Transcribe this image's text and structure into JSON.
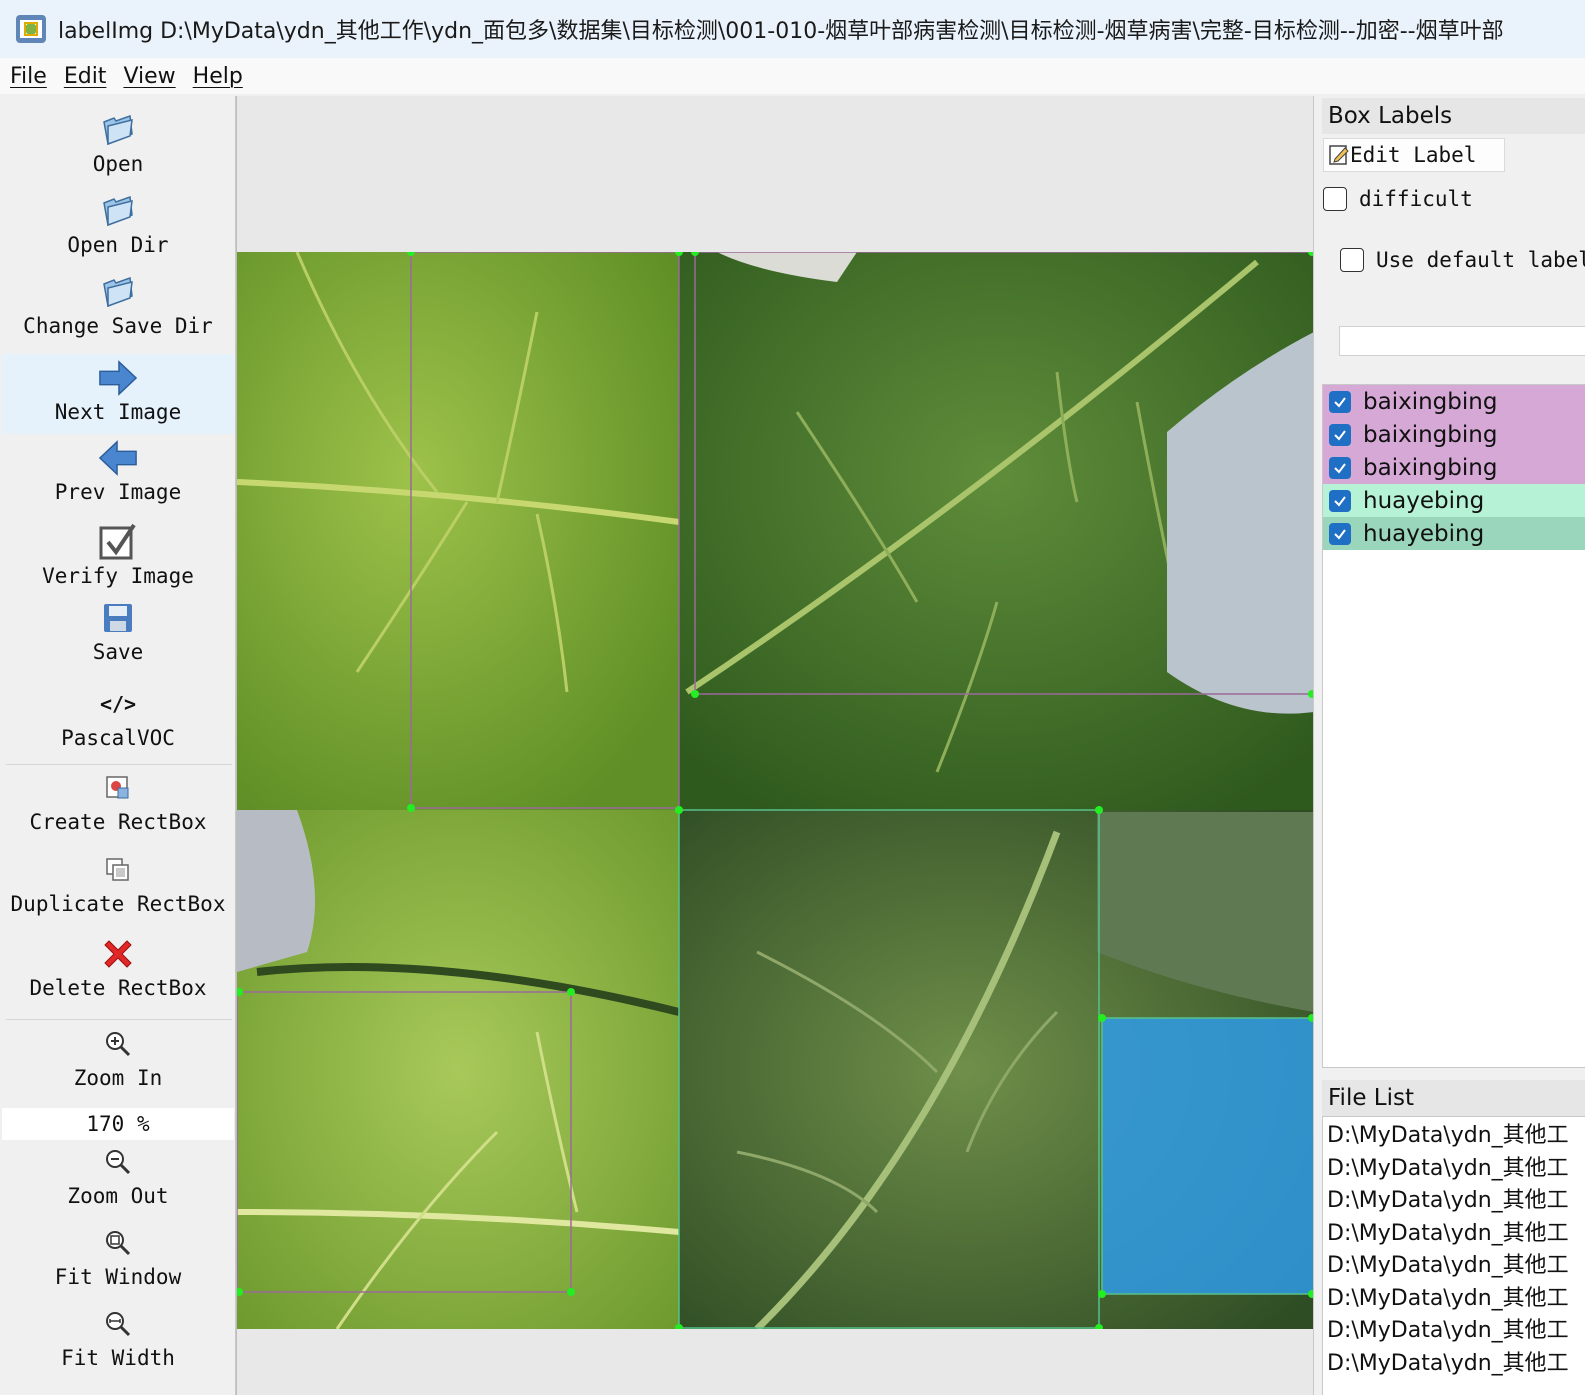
{
  "window": {
    "title": "labelImg D:\\MyData\\ydn_其他工作\\ydn_面包多\\数据集\\目标检测\\001-010-烟草叶部病害检测\\目标检测-烟草病害\\完整-目标检测--加密--烟草叶部",
    "app_icon": "labelimg-app-icon"
  },
  "menu": {
    "file": "File",
    "edit": "Edit",
    "view": "View",
    "help": "Help"
  },
  "toolbar": {
    "open": "Open",
    "open_dir": "Open Dir",
    "change_save_dir": "Change Save Dir",
    "next_image": "Next Image",
    "prev_image": "Prev Image",
    "verify_image": "Verify Image",
    "save": "Save",
    "pascalvoc": "PascalVOC",
    "pascalvoc_icon_text": "</>",
    "create_rectbox": "Create RectBox",
    "duplicate_rectbox": "Duplicate RectBox",
    "delete_rectbox": "Delete RectBox",
    "zoom_in": "Zoom In",
    "zoom_value": "170 %",
    "zoom_out": "Zoom Out",
    "fit_window": "Fit Window",
    "fit_width": "Fit Width"
  },
  "box_labels": {
    "title": "Box Labels",
    "edit_label": "Edit Label",
    "difficult": "difficult",
    "use_default_label": "Use default label",
    "items": [
      {
        "label": "baixingbing",
        "checked": true,
        "color": "#d6a8d6"
      },
      {
        "label": "baixingbing",
        "checked": true,
        "color": "#d6a8d6"
      },
      {
        "label": "baixingbing",
        "checked": true,
        "color": "#d6a8d6"
      },
      {
        "label": "huayebing",
        "checked": true,
        "color": "#b6f2d6"
      },
      {
        "label": "huayebing",
        "checked": true,
        "color": "#9ad6bc"
      }
    ]
  },
  "file_list": {
    "title": "File List",
    "items": [
      "D:\\MyData\\ydn_其他工",
      "D:\\MyData\\ydn_其他工",
      "D:\\MyData\\ydn_其他工",
      "D:\\MyData\\ydn_其他工",
      "D:\\MyData\\ydn_其他工",
      "D:\\MyData\\ydn_其他工",
      "D:\\MyData\\ydn_其他工",
      "D:\\MyData\\ydn_其他工"
    ]
  },
  "colors": {
    "baixingbing_box": "#9a6a9a",
    "huayebing_box": "#56c28a",
    "selected_box_fill": "#2f9be6",
    "vertex": "#22ee22",
    "active_tool_bg": "#e5f1fb",
    "checkbox_blue": "#1f6fc5"
  }
}
